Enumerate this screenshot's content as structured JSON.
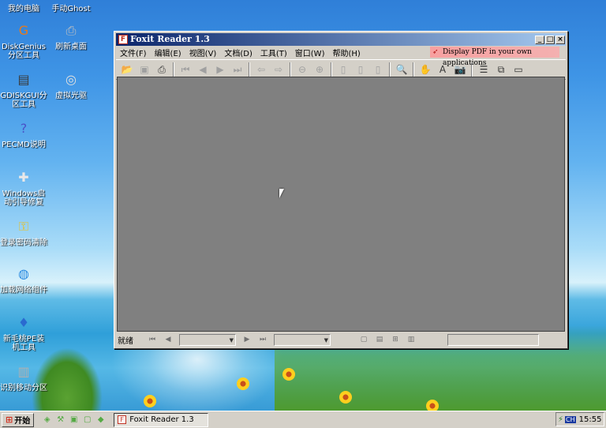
{
  "desktop": {
    "icons": [
      {
        "label": "我的电脑",
        "glyph": "▭",
        "color": "#5a84c8"
      },
      {
        "label": "手动Ghost",
        "glyph": "◉",
        "color": "#d8d8d8"
      },
      {
        "label": "DiskGenius分区工具",
        "glyph": "G",
        "color": "#e87a1a"
      },
      {
        "label": "刷新桌面",
        "glyph": "⎙",
        "color": "#c0c0c0"
      },
      {
        "label": "GDISKGUI分区工具",
        "glyph": "▤",
        "color": "#3a3a3a"
      },
      {
        "label": "虚拟光驱",
        "glyph": "◎",
        "color": "#e0e0e0"
      },
      {
        "label": "PECMD说明",
        "glyph": "?",
        "color": "#4a52c8"
      },
      {
        "label": "Windows启动引导修复",
        "glyph": "✚",
        "color": "#e8e8e8"
      },
      {
        "label": "登录密码清除",
        "glyph": "⚿",
        "color": "#e8c020"
      },
      {
        "label": "加载网络组件",
        "glyph": "◍",
        "color": "#2a8ae0"
      },
      {
        "label": "新毛桃PE装机工具",
        "glyph": "♦",
        "color": "#2a6ad0"
      },
      {
        "label": "识别移动分区",
        "glyph": "▥",
        "color": "#b0b0b0"
      }
    ]
  },
  "window": {
    "title": "Foxit Reader 1.3",
    "app_icon": "F",
    "controls": {
      "minimize": "_",
      "maximize": "□",
      "close": "×"
    },
    "menu": [
      "文件(F)",
      "编辑(E)",
      "视图(V)",
      "文档(D)",
      "工具(T)",
      "窗口(W)",
      "帮助(H)"
    ],
    "ad_banner": "Display PDF in your own applications",
    "toolbar": [
      {
        "name": "open-icon",
        "glyph": "📂",
        "enabled": true
      },
      {
        "name": "save-icon",
        "glyph": "▣",
        "enabled": false
      },
      {
        "name": "print-icon",
        "glyph": "⎙",
        "enabled": true
      },
      {
        "name": "sep"
      },
      {
        "name": "first-page-icon",
        "glyph": "⏮",
        "enabled": false
      },
      {
        "name": "prev-page-icon",
        "glyph": "◀",
        "enabled": false
      },
      {
        "name": "next-page-icon",
        "glyph": "▶",
        "enabled": false
      },
      {
        "name": "last-page-icon",
        "glyph": "⏭",
        "enabled": false
      },
      {
        "name": "sep"
      },
      {
        "name": "back-icon",
        "glyph": "⇦",
        "enabled": false
      },
      {
        "name": "forward-icon",
        "glyph": "⇨",
        "enabled": false
      },
      {
        "name": "sep"
      },
      {
        "name": "zoom-out-icon",
        "glyph": "⊖",
        "enabled": false
      },
      {
        "name": "zoom-in-icon",
        "glyph": "⊕",
        "enabled": false
      },
      {
        "name": "sep"
      },
      {
        "name": "actual-size-icon",
        "glyph": "▯",
        "enabled": false
      },
      {
        "name": "fit-page-icon",
        "glyph": "▯",
        "enabled": false
      },
      {
        "name": "fit-width-icon",
        "glyph": "▯",
        "enabled": false
      },
      {
        "name": "sep"
      },
      {
        "name": "find-icon",
        "glyph": "🔍",
        "enabled": true
      },
      {
        "name": "sep"
      },
      {
        "name": "hand-tool-icon",
        "glyph": "✋",
        "enabled": true
      },
      {
        "name": "text-select-icon",
        "glyph": "A",
        "enabled": true
      },
      {
        "name": "snapshot-icon",
        "glyph": "📷",
        "enabled": true
      },
      {
        "name": "sep"
      },
      {
        "name": "bookmarks-panel-icon",
        "glyph": "☰",
        "enabled": true
      },
      {
        "name": "continuous-view-icon",
        "glyph": "⧉",
        "enabled": true
      },
      {
        "name": "full-screen-icon",
        "glyph": "▭",
        "enabled": true
      }
    ],
    "status": {
      "text": "就绪"
    }
  },
  "taskbar": {
    "start_label": "开始",
    "quicklaunch": [
      "ql-1",
      "ql-2",
      "ql-3",
      "ql-4",
      "ql-5"
    ],
    "task_label": "Foxit Reader 1.3",
    "ime": "CH",
    "clock": "15:55"
  }
}
